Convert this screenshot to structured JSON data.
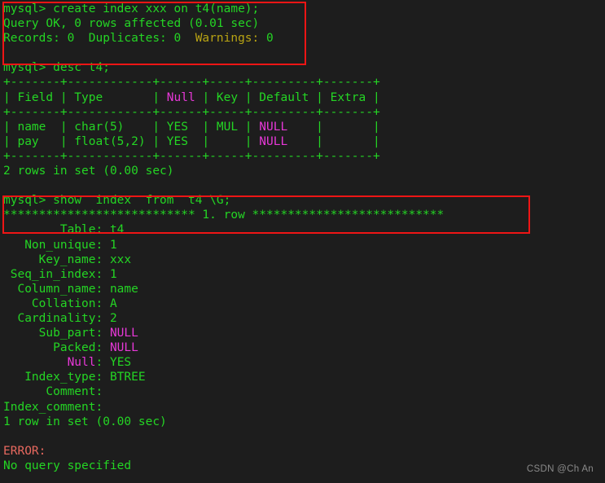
{
  "terminal": {
    "background_color": "#1d1d1d",
    "text_color": "#24d524",
    "magenta_color": "#e838d8",
    "yellow_color": "#b8a313",
    "error_color": "#e8695f",
    "highlight_box_color": "#ee1515"
  },
  "watermark": {
    "text": "CSDN @Ch An"
  },
  "lines": [
    {
      "id": "l01",
      "segments": [
        {
          "text": "mysql> create index xxx on t4(name);",
          "color": "g"
        }
      ]
    },
    {
      "id": "l02",
      "segments": [
        {
          "text": "Query OK, 0 rows affected (0.01 sec)",
          "color": "g"
        }
      ]
    },
    {
      "id": "l03",
      "segments": [
        {
          "text": "Records: 0  Duplicates: 0  ",
          "color": "g"
        },
        {
          "text": "Warnings:",
          "color": "yel"
        },
        {
          "text": " 0",
          "color": "g"
        }
      ]
    },
    {
      "id": "l04",
      "segments": [
        {
          "text": "",
          "color": "g"
        }
      ]
    },
    {
      "id": "l05",
      "segments": [
        {
          "text": "mysql> desc t4;",
          "color": "g"
        }
      ]
    },
    {
      "id": "l06",
      "segments": [
        {
          "text": "+-------+------------+------+-----+---------+-------+",
          "color": "g"
        }
      ]
    },
    {
      "id": "l07",
      "segments": [
        {
          "text": "| Field | Type       | ",
          "color": "g"
        },
        {
          "text": "Null",
          "color": "mag"
        },
        {
          "text": " | Key | Default | Extra |",
          "color": "g"
        }
      ]
    },
    {
      "id": "l08",
      "segments": [
        {
          "text": "+-------+------------+------+-----+---------+-------+",
          "color": "g"
        }
      ]
    },
    {
      "id": "l09",
      "segments": [
        {
          "text": "| name  | char(5)    | YES  | MUL | ",
          "color": "g"
        },
        {
          "text": "NULL",
          "color": "mag"
        },
        {
          "text": "    |       |",
          "color": "g"
        }
      ]
    },
    {
      "id": "l10",
      "segments": [
        {
          "text": "| pay   | float(5,2) | YES  |     | ",
          "color": "g"
        },
        {
          "text": "NULL",
          "color": "mag"
        },
        {
          "text": "    |       |",
          "color": "g"
        }
      ]
    },
    {
      "id": "l11",
      "segments": [
        {
          "text": "+-------+------------+------+-----+---------+-------+",
          "color": "g"
        }
      ]
    },
    {
      "id": "l12",
      "segments": [
        {
          "text": "2 rows in set (0.00 sec)",
          "color": "g"
        }
      ]
    },
    {
      "id": "l13",
      "segments": [
        {
          "text": "",
          "color": "g"
        }
      ]
    },
    {
      "id": "l14",
      "segments": [
        {
          "text": "mysql> show  index  from  t4 \\G;",
          "color": "g"
        }
      ]
    },
    {
      "id": "l15",
      "segments": [
        {
          "text": "*************************** 1. row ***************************",
          "color": "g"
        }
      ]
    },
    {
      "id": "l16",
      "segments": [
        {
          "text": "        Table: t4",
          "color": "g"
        }
      ]
    },
    {
      "id": "l17",
      "segments": [
        {
          "text": "   Non_unique: 1",
          "color": "g"
        }
      ]
    },
    {
      "id": "l18",
      "segments": [
        {
          "text": "     Key_name: xxx",
          "color": "g"
        }
      ]
    },
    {
      "id": "l19",
      "segments": [
        {
          "text": " Seq_in_index: 1",
          "color": "g"
        }
      ]
    },
    {
      "id": "l20",
      "segments": [
        {
          "text": "  Column_name: name",
          "color": "g"
        }
      ]
    },
    {
      "id": "l21",
      "segments": [
        {
          "text": "    Collation: A",
          "color": "g"
        }
      ]
    },
    {
      "id": "l22",
      "segments": [
        {
          "text": "  Cardinality: 2",
          "color": "g"
        }
      ]
    },
    {
      "id": "l23",
      "segments": [
        {
          "text": "     Sub_part: ",
          "color": "g"
        },
        {
          "text": "NULL",
          "color": "mag"
        }
      ]
    },
    {
      "id": "l24",
      "segments": [
        {
          "text": "       Packed: ",
          "color": "g"
        },
        {
          "text": "NULL",
          "color": "mag"
        }
      ]
    },
    {
      "id": "l25",
      "segments": [
        {
          "text": "         ",
          "color": "g"
        },
        {
          "text": "Null",
          "color": "mag"
        },
        {
          "text": ": YES",
          "color": "g"
        }
      ]
    },
    {
      "id": "l26",
      "segments": [
        {
          "text": "   Index_type: BTREE",
          "color": "g"
        }
      ]
    },
    {
      "id": "l27",
      "segments": [
        {
          "text": "      Comment: ",
          "color": "g"
        }
      ]
    },
    {
      "id": "l28",
      "segments": [
        {
          "text": "Index_comment: ",
          "color": "g"
        }
      ]
    },
    {
      "id": "l29",
      "segments": [
        {
          "text": "1 row in set (0.00 sec)",
          "color": "g"
        }
      ]
    },
    {
      "id": "l30",
      "segments": [
        {
          "text": "",
          "color": "g"
        }
      ]
    },
    {
      "id": "l31",
      "segments": [
        {
          "text": "ERROR:",
          "color": "red"
        }
      ]
    },
    {
      "id": "l32",
      "segments": [
        {
          "text": "No query specified",
          "color": "g"
        }
      ]
    }
  ]
}
